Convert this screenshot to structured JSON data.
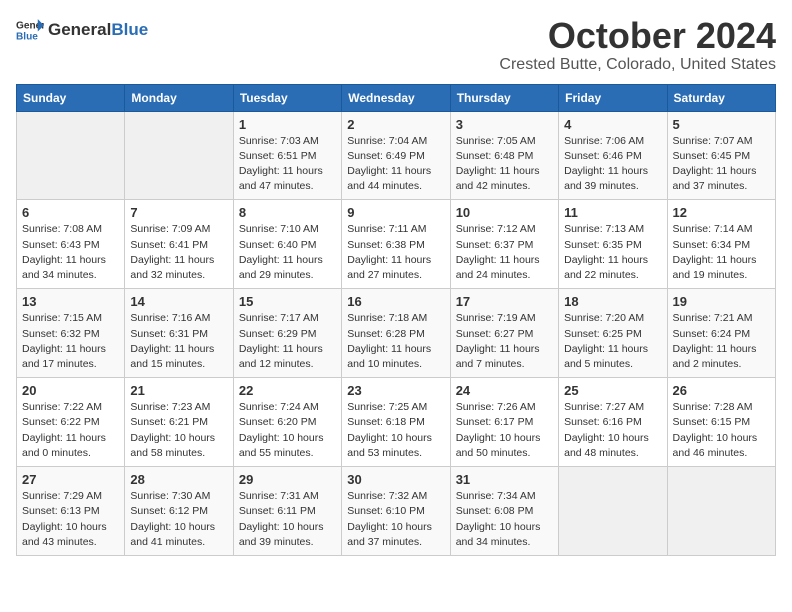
{
  "header": {
    "logo": {
      "general": "General",
      "blue": "Blue"
    },
    "month": "October 2024",
    "location": "Crested Butte, Colorado, United States"
  },
  "days_of_week": [
    "Sunday",
    "Monday",
    "Tuesday",
    "Wednesday",
    "Thursday",
    "Friday",
    "Saturday"
  ],
  "weeks": [
    [
      {
        "day": "",
        "sunrise": "",
        "sunset": "",
        "daylight": ""
      },
      {
        "day": "",
        "sunrise": "",
        "sunset": "",
        "daylight": ""
      },
      {
        "day": "1",
        "sunrise": "Sunrise: 7:03 AM",
        "sunset": "Sunset: 6:51 PM",
        "daylight": "Daylight: 11 hours and 47 minutes."
      },
      {
        "day": "2",
        "sunrise": "Sunrise: 7:04 AM",
        "sunset": "Sunset: 6:49 PM",
        "daylight": "Daylight: 11 hours and 44 minutes."
      },
      {
        "day": "3",
        "sunrise": "Sunrise: 7:05 AM",
        "sunset": "Sunset: 6:48 PM",
        "daylight": "Daylight: 11 hours and 42 minutes."
      },
      {
        "day": "4",
        "sunrise": "Sunrise: 7:06 AM",
        "sunset": "Sunset: 6:46 PM",
        "daylight": "Daylight: 11 hours and 39 minutes."
      },
      {
        "day": "5",
        "sunrise": "Sunrise: 7:07 AM",
        "sunset": "Sunset: 6:45 PM",
        "daylight": "Daylight: 11 hours and 37 minutes."
      }
    ],
    [
      {
        "day": "6",
        "sunrise": "Sunrise: 7:08 AM",
        "sunset": "Sunset: 6:43 PM",
        "daylight": "Daylight: 11 hours and 34 minutes."
      },
      {
        "day": "7",
        "sunrise": "Sunrise: 7:09 AM",
        "sunset": "Sunset: 6:41 PM",
        "daylight": "Daylight: 11 hours and 32 minutes."
      },
      {
        "day": "8",
        "sunrise": "Sunrise: 7:10 AM",
        "sunset": "Sunset: 6:40 PM",
        "daylight": "Daylight: 11 hours and 29 minutes."
      },
      {
        "day": "9",
        "sunrise": "Sunrise: 7:11 AM",
        "sunset": "Sunset: 6:38 PM",
        "daylight": "Daylight: 11 hours and 27 minutes."
      },
      {
        "day": "10",
        "sunrise": "Sunrise: 7:12 AM",
        "sunset": "Sunset: 6:37 PM",
        "daylight": "Daylight: 11 hours and 24 minutes."
      },
      {
        "day": "11",
        "sunrise": "Sunrise: 7:13 AM",
        "sunset": "Sunset: 6:35 PM",
        "daylight": "Daylight: 11 hours and 22 minutes."
      },
      {
        "day": "12",
        "sunrise": "Sunrise: 7:14 AM",
        "sunset": "Sunset: 6:34 PM",
        "daylight": "Daylight: 11 hours and 19 minutes."
      }
    ],
    [
      {
        "day": "13",
        "sunrise": "Sunrise: 7:15 AM",
        "sunset": "Sunset: 6:32 PM",
        "daylight": "Daylight: 11 hours and 17 minutes."
      },
      {
        "day": "14",
        "sunrise": "Sunrise: 7:16 AM",
        "sunset": "Sunset: 6:31 PM",
        "daylight": "Daylight: 11 hours and 15 minutes."
      },
      {
        "day": "15",
        "sunrise": "Sunrise: 7:17 AM",
        "sunset": "Sunset: 6:29 PM",
        "daylight": "Daylight: 11 hours and 12 minutes."
      },
      {
        "day": "16",
        "sunrise": "Sunrise: 7:18 AM",
        "sunset": "Sunset: 6:28 PM",
        "daylight": "Daylight: 11 hours and 10 minutes."
      },
      {
        "day": "17",
        "sunrise": "Sunrise: 7:19 AM",
        "sunset": "Sunset: 6:27 PM",
        "daylight": "Daylight: 11 hours and 7 minutes."
      },
      {
        "day": "18",
        "sunrise": "Sunrise: 7:20 AM",
        "sunset": "Sunset: 6:25 PM",
        "daylight": "Daylight: 11 hours and 5 minutes."
      },
      {
        "day": "19",
        "sunrise": "Sunrise: 7:21 AM",
        "sunset": "Sunset: 6:24 PM",
        "daylight": "Daylight: 11 hours and 2 minutes."
      }
    ],
    [
      {
        "day": "20",
        "sunrise": "Sunrise: 7:22 AM",
        "sunset": "Sunset: 6:22 PM",
        "daylight": "Daylight: 11 hours and 0 minutes."
      },
      {
        "day": "21",
        "sunrise": "Sunrise: 7:23 AM",
        "sunset": "Sunset: 6:21 PM",
        "daylight": "Daylight: 10 hours and 58 minutes."
      },
      {
        "day": "22",
        "sunrise": "Sunrise: 7:24 AM",
        "sunset": "Sunset: 6:20 PM",
        "daylight": "Daylight: 10 hours and 55 minutes."
      },
      {
        "day": "23",
        "sunrise": "Sunrise: 7:25 AM",
        "sunset": "Sunset: 6:18 PM",
        "daylight": "Daylight: 10 hours and 53 minutes."
      },
      {
        "day": "24",
        "sunrise": "Sunrise: 7:26 AM",
        "sunset": "Sunset: 6:17 PM",
        "daylight": "Daylight: 10 hours and 50 minutes."
      },
      {
        "day": "25",
        "sunrise": "Sunrise: 7:27 AM",
        "sunset": "Sunset: 6:16 PM",
        "daylight": "Daylight: 10 hours and 48 minutes."
      },
      {
        "day": "26",
        "sunrise": "Sunrise: 7:28 AM",
        "sunset": "Sunset: 6:15 PM",
        "daylight": "Daylight: 10 hours and 46 minutes."
      }
    ],
    [
      {
        "day": "27",
        "sunrise": "Sunrise: 7:29 AM",
        "sunset": "Sunset: 6:13 PM",
        "daylight": "Daylight: 10 hours and 43 minutes."
      },
      {
        "day": "28",
        "sunrise": "Sunrise: 7:30 AM",
        "sunset": "Sunset: 6:12 PM",
        "daylight": "Daylight: 10 hours and 41 minutes."
      },
      {
        "day": "29",
        "sunrise": "Sunrise: 7:31 AM",
        "sunset": "Sunset: 6:11 PM",
        "daylight": "Daylight: 10 hours and 39 minutes."
      },
      {
        "day": "30",
        "sunrise": "Sunrise: 7:32 AM",
        "sunset": "Sunset: 6:10 PM",
        "daylight": "Daylight: 10 hours and 37 minutes."
      },
      {
        "day": "31",
        "sunrise": "Sunrise: 7:34 AM",
        "sunset": "Sunset: 6:08 PM",
        "daylight": "Daylight: 10 hours and 34 minutes."
      },
      {
        "day": "",
        "sunrise": "",
        "sunset": "",
        "daylight": ""
      },
      {
        "day": "",
        "sunrise": "",
        "sunset": "",
        "daylight": ""
      }
    ]
  ]
}
